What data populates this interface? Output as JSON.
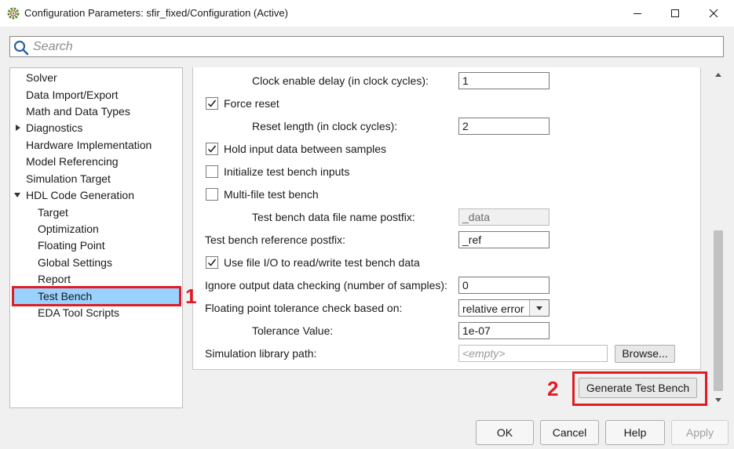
{
  "window": {
    "title": "Configuration Parameters: sfir_fixed/Configuration (Active)",
    "app_icon": "gear-icon",
    "controls": [
      "minimize-icon",
      "maximize-icon",
      "close-icon"
    ]
  },
  "search": {
    "placeholder": "Search",
    "value": ""
  },
  "sidebar": {
    "items": [
      {
        "label": "Solver",
        "level": 0
      },
      {
        "label": "Data Import/Export",
        "level": 0
      },
      {
        "label": "Math and Data Types",
        "level": 0
      },
      {
        "label": "Diagnostics",
        "level": 0,
        "expandable": true,
        "expanded": false
      },
      {
        "label": "Hardware Implementation",
        "level": 0
      },
      {
        "label": "Model Referencing",
        "level": 0
      },
      {
        "label": "Simulation Target",
        "level": 0
      },
      {
        "label": "HDL Code Generation",
        "level": 0,
        "expandable": true,
        "expanded": true
      },
      {
        "label": "Target",
        "level": 1
      },
      {
        "label": "Optimization",
        "level": 1
      },
      {
        "label": "Floating Point",
        "level": 1
      },
      {
        "label": "Global Settings",
        "level": 1
      },
      {
        "label": "Report",
        "level": 1
      },
      {
        "label": "Test Bench",
        "level": 1,
        "selected": true
      },
      {
        "label": "EDA Tool Scripts",
        "level": 1
      }
    ]
  },
  "settings": {
    "clock_enable_delay": {
      "label": "Clock enable delay (in clock cycles):",
      "value": "1"
    },
    "force_reset": {
      "label": "Force reset",
      "checked": true
    },
    "reset_length": {
      "label": "Reset length (in clock cycles):",
      "value": "2"
    },
    "hold_input": {
      "label": "Hold input data between samples",
      "checked": true
    },
    "init_inputs": {
      "label": "Initialize test bench inputs",
      "checked": false
    },
    "multi_file": {
      "label": "Multi-file test bench",
      "checked": false
    },
    "data_file_postfix": {
      "label": "Test bench data file name postfix:",
      "value": "_data"
    },
    "reference_postfix": {
      "label": "Test bench reference postfix:",
      "value": "_ref"
    },
    "use_file_io": {
      "label": "Use file I/O to read/write test bench data",
      "checked": true
    },
    "ignore_output": {
      "label": "Ignore output data checking (number of samples):",
      "value": "0"
    },
    "fp_tolerance": {
      "label": "Floating point tolerance check based on:",
      "value": "relative error"
    },
    "tolerance_value": {
      "label": "Tolerance Value:",
      "value": "1e-07"
    },
    "sim_library": {
      "label": "Simulation library path:",
      "value": "<empty>"
    },
    "browse_label": "Browse..."
  },
  "generate_label": "Generate Test Bench",
  "annotations": {
    "one": "1",
    "two": "2"
  },
  "footer": {
    "ok": "OK",
    "cancel": "Cancel",
    "help": "Help",
    "apply": "Apply"
  },
  "colors": {
    "selection": "#99d1ff",
    "annotation_red": "#e01c24"
  }
}
